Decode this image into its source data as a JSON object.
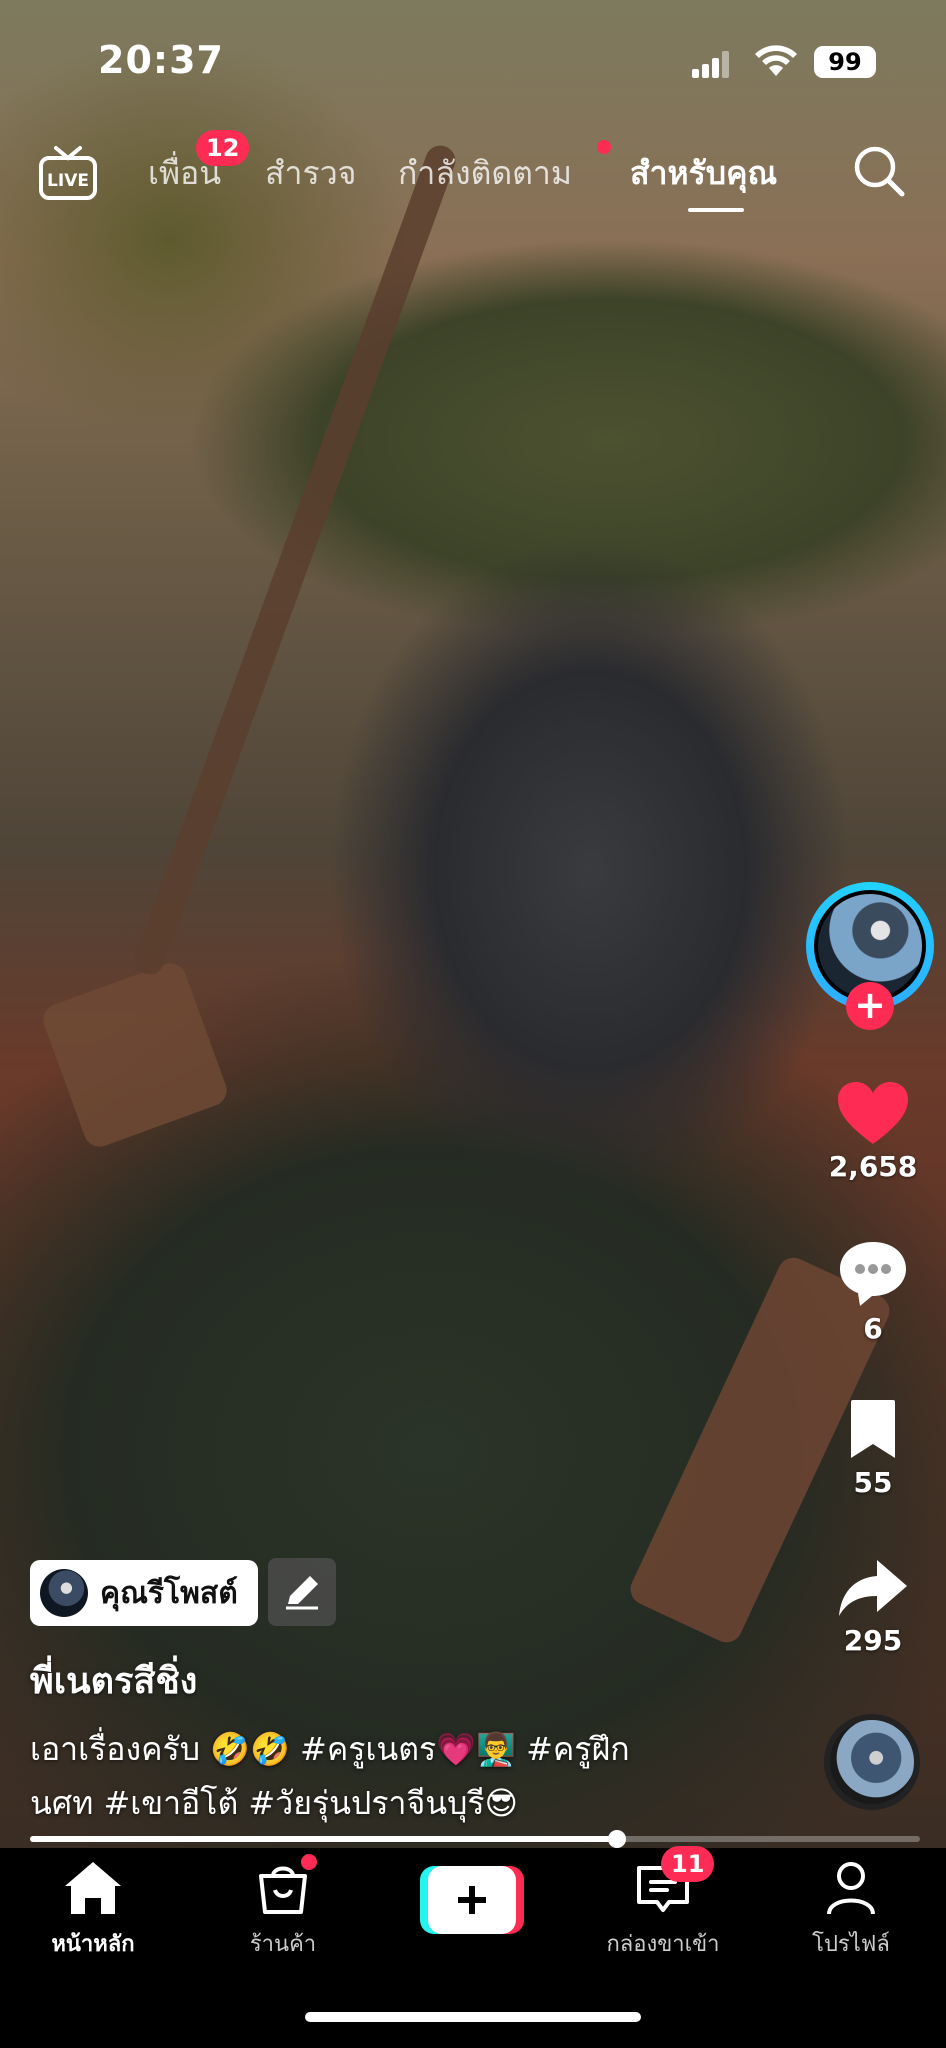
{
  "status_bar": {
    "time": "20:37",
    "battery": "99"
  },
  "top_nav": {
    "live_label": "LIVE",
    "tabs": [
      {
        "label": "เพื่อน",
        "badge": "12"
      },
      {
        "label": "สำรวจ"
      },
      {
        "label": "กำลังติดตาม",
        "dot": true
      },
      {
        "label": "สำหรับคุณ",
        "active": true
      }
    ]
  },
  "side_actions": {
    "likes": "2,658",
    "comments": "6",
    "saves": "55",
    "shares": "295"
  },
  "post": {
    "username": "คุณรีโพสต์",
    "title": "พี่เนตรสีชิ่ง",
    "caption_line1": "เอาเรื่องครับ 🤣🤣 #ครูเนตร💗👨‍🏫 #ครูฝึก",
    "caption_line2": "นศท #เขาอีโต้ #วัยรุ่นปราจีนบุรี😎",
    "progress": 0.66
  },
  "bottom_nav": {
    "items": [
      {
        "label": "หน้าหลัก",
        "active": true
      },
      {
        "label": "ร้านค้า",
        "dot": true
      },
      {
        "label": ""
      },
      {
        "label": "กล่องขาเข้า",
        "badge": "11"
      },
      {
        "label": "โปรไฟล์"
      }
    ]
  },
  "colors": {
    "accent": "#fe2c55",
    "ring": "#21d4fd",
    "create_left": "#25f4ee",
    "create_right": "#fe2c55"
  }
}
